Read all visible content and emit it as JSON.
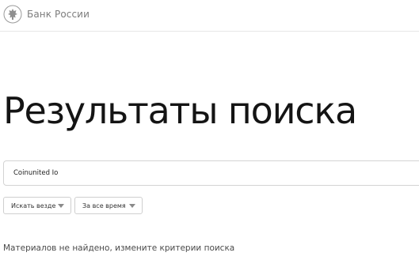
{
  "header": {
    "logo_text": "Банк России",
    "logo_icon": "double-headed-eagle-emblem"
  },
  "page": {
    "title": "Результаты поиска"
  },
  "search": {
    "value": "Coinunited Io"
  },
  "filters": {
    "where": {
      "label": "Искать везде"
    },
    "when": {
      "label": "За все время"
    }
  },
  "results": {
    "empty_message": "Материалов не найдено, измените критерии поиска"
  }
}
